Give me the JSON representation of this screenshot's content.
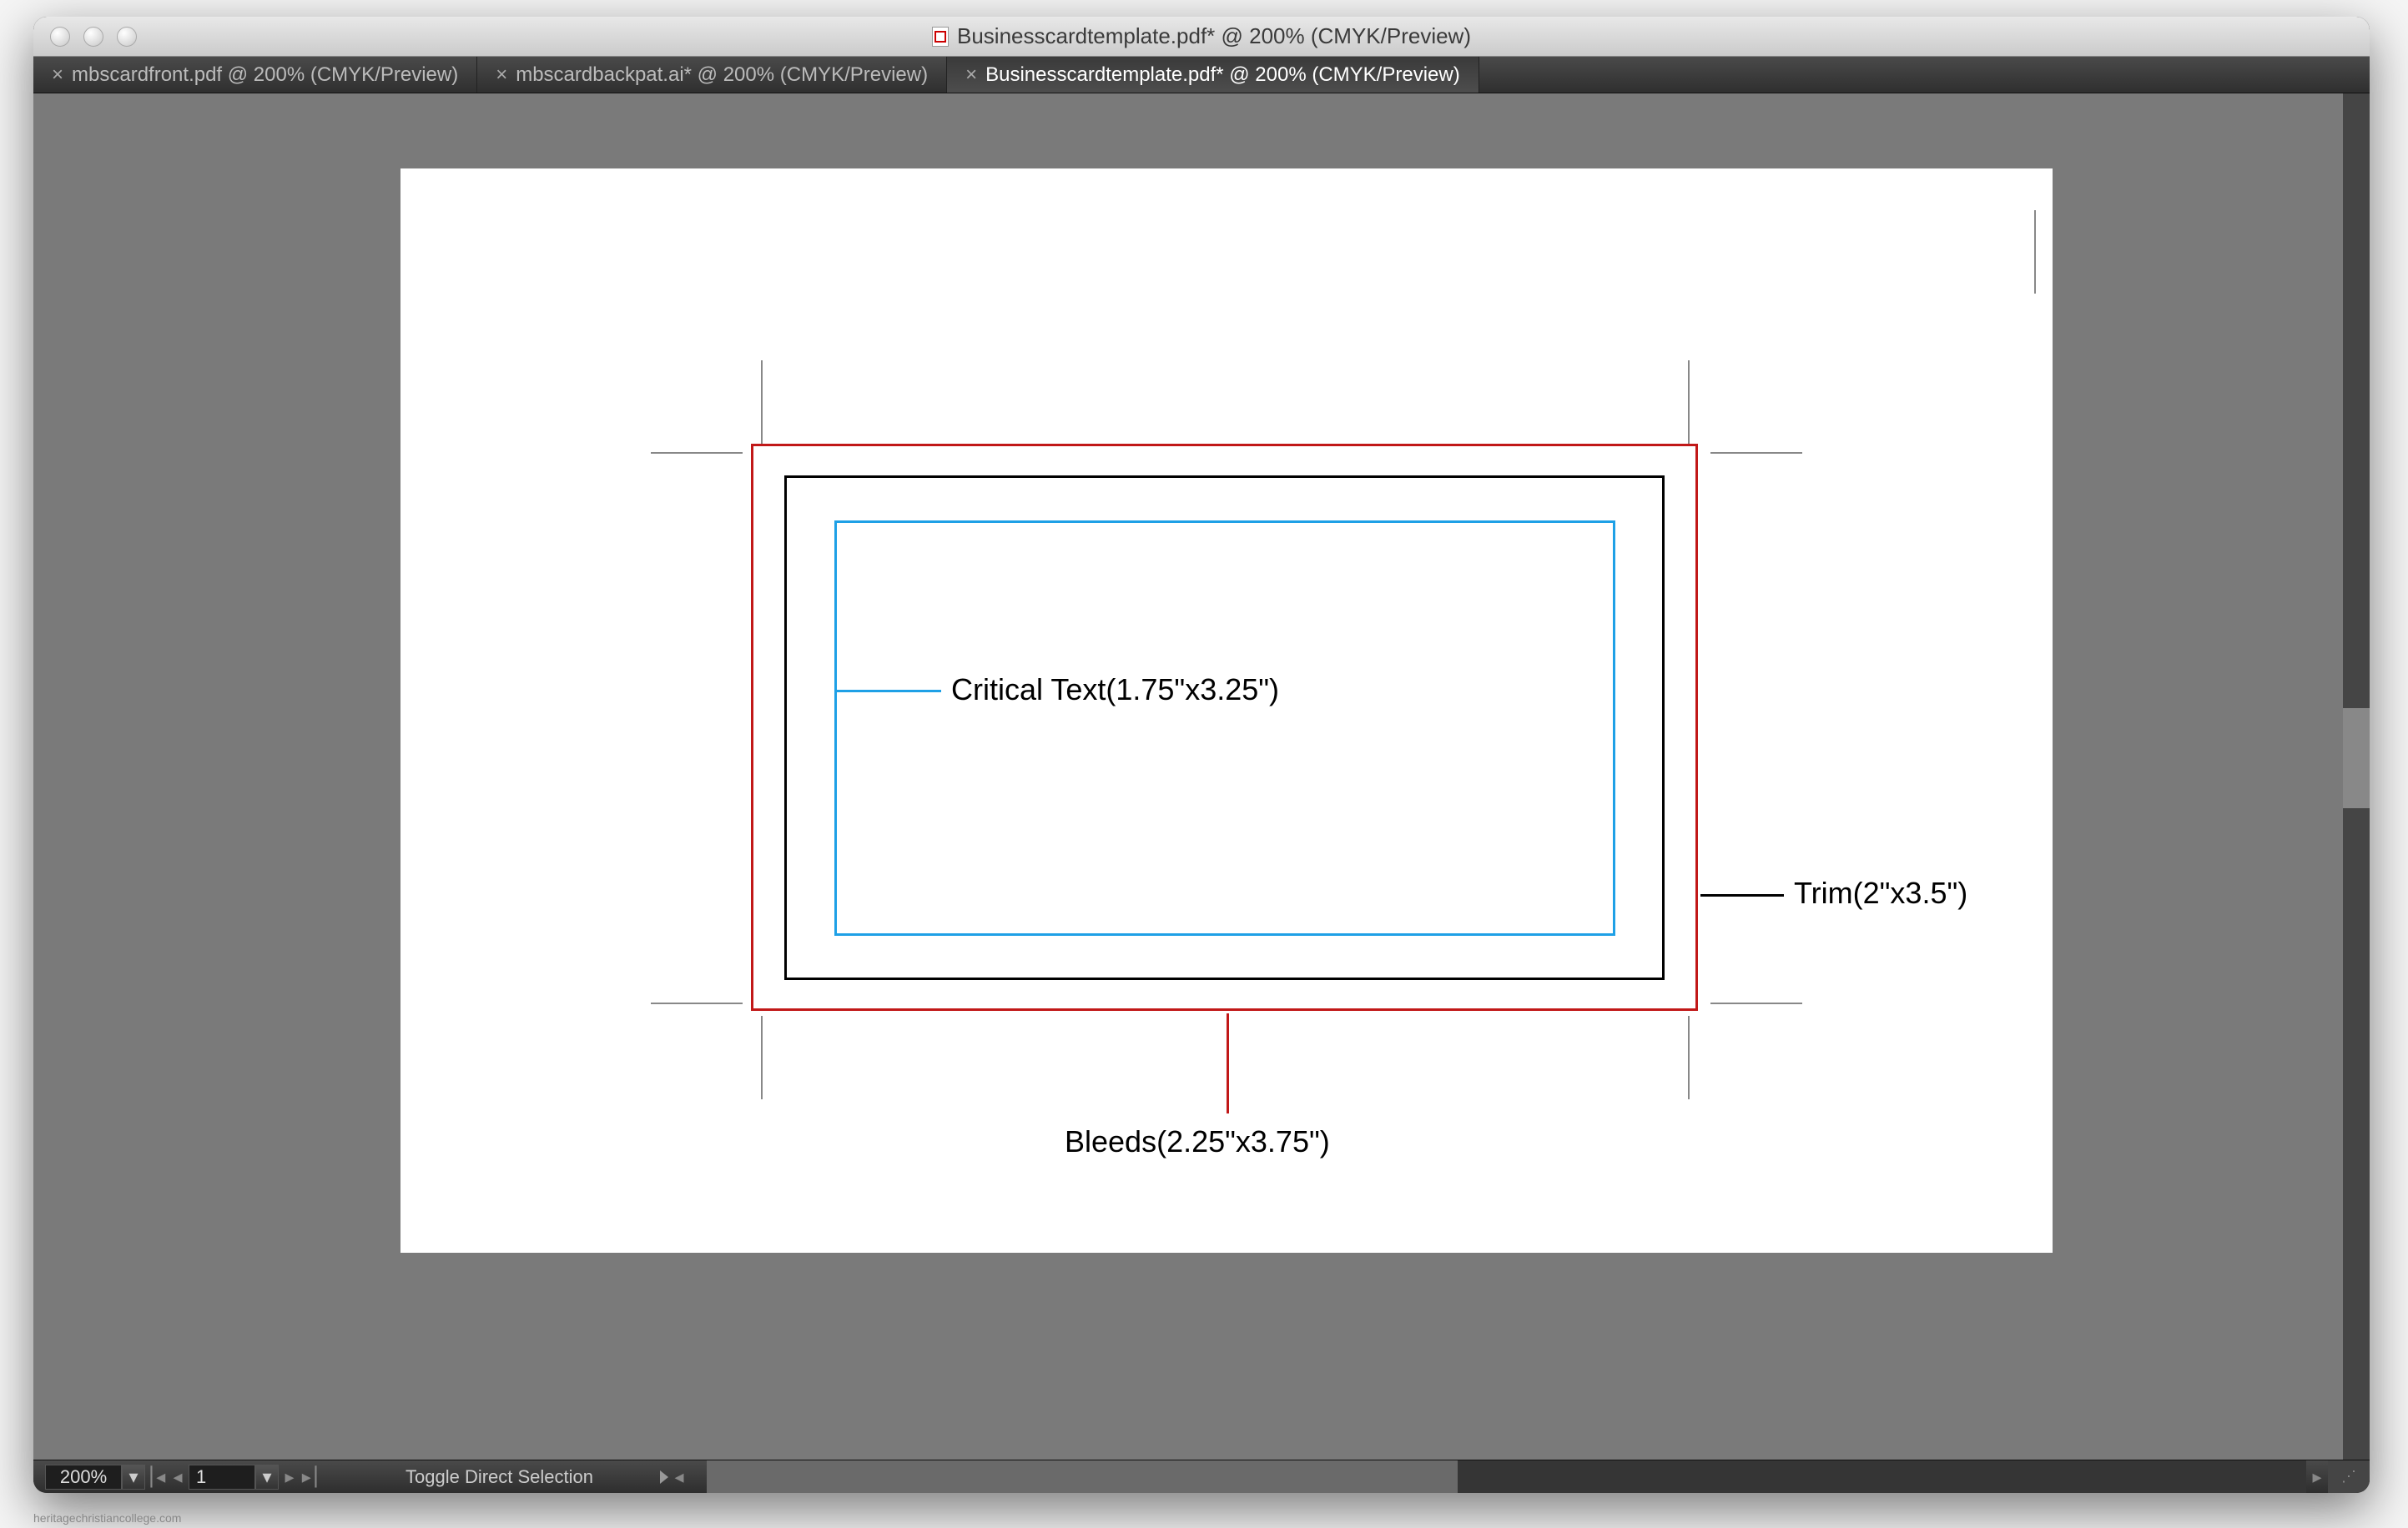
{
  "window": {
    "title": "Businesscardtemplate.pdf* @ 200% (CMYK/Preview)"
  },
  "tabs": [
    {
      "label": "mbscardfront.pdf @ 200% (CMYK/Preview)",
      "active": false
    },
    {
      "label": "mbscardbackpat.ai* @ 200% (CMYK/Preview)",
      "active": false
    },
    {
      "label": "Businesscardtemplate.pdf* @ 200% (CMYK/Preview)",
      "active": true
    }
  ],
  "diagram": {
    "critical_label": "Critical Text(1.75\"x3.25\")",
    "trim_label": "Trim(2\"x3.5\")",
    "bleed_label": "Bleeds(2.25\"x3.75\")",
    "colors": {
      "bleed": "#c11818",
      "trim": "#000000",
      "critical": "#1ea0e6"
    }
  },
  "statusbar": {
    "zoom": "200%",
    "page": "1",
    "tool_hint": "Toggle Direct Selection"
  },
  "watermark": "heritagechristiancollege.com"
}
